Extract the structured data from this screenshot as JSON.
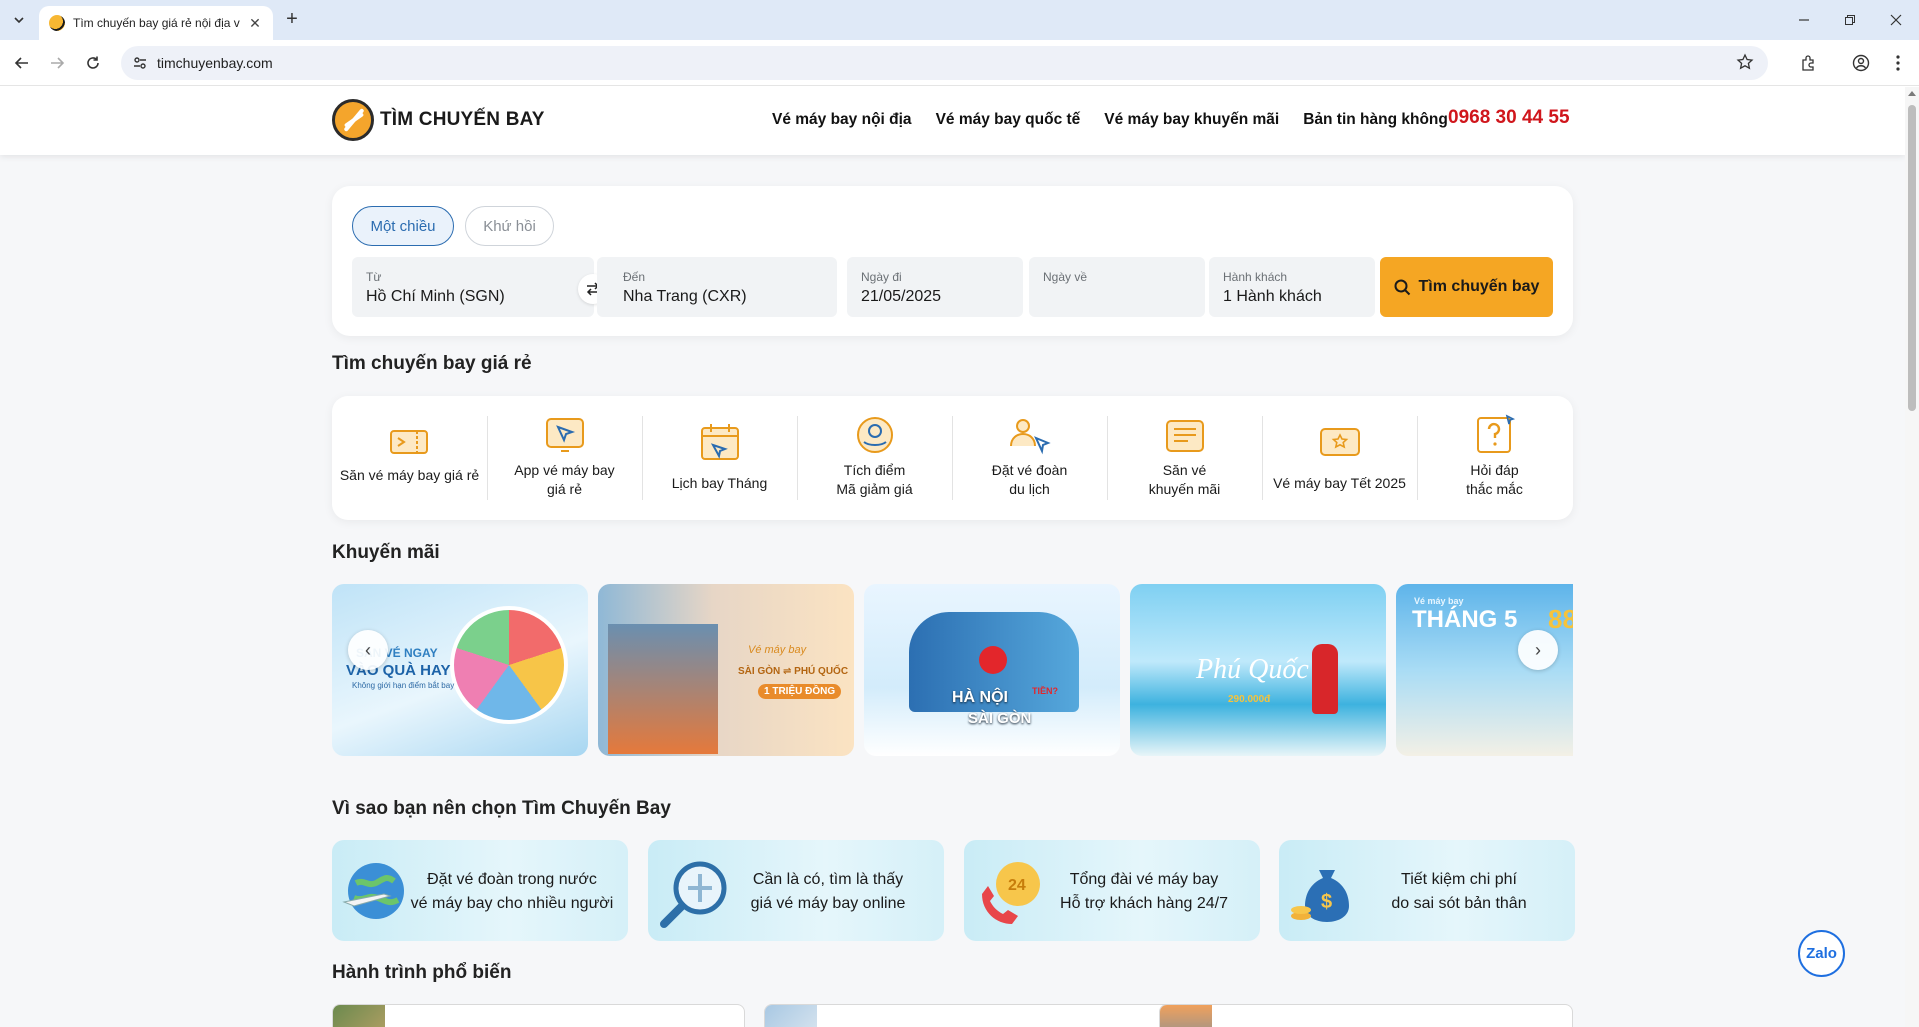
{
  "browser": {
    "tab_title": "Tìm chuyến bay giá rẻ nội địa v",
    "url": "timchuyenbay.com"
  },
  "header": {
    "brand": "TÌM CHUYẾN BAY",
    "nav": [
      "Vé máy bay nội địa",
      "Vé máy bay quốc tế",
      "Vé máy bay khuyến mãi",
      "Bản tin hàng không"
    ],
    "hotline": "0968 30 44 55"
  },
  "search": {
    "trip_oneway": "Một chiều",
    "trip_roundtrip": "Khứ hồi",
    "from_label": "Từ",
    "from_value": "Hồ Chí Minh (SGN)",
    "to_label": "Đến",
    "to_value": "Nha Trang (CXR)",
    "depart_label": "Ngày đi",
    "depart_value": "21/05/2025",
    "return_label": "Ngày về",
    "return_value": "",
    "pax_label": "Hành khách",
    "pax_value": "1 Hành khách",
    "button": "Tìm chuyến bay"
  },
  "features_title": "Tìm chuyến bay giá rẻ",
  "features": [
    {
      "line1": "Săn vé máy bay giá rẻ",
      "line2": "",
      "icon": "ticket-icon"
    },
    {
      "line1": "App vé máy bay",
      "line2": "giá rẻ",
      "icon": "app-icon"
    },
    {
      "line1": "Lịch bay Tháng",
      "line2": "",
      "icon": "calendar-icon"
    },
    {
      "line1": "Tích điểm",
      "line2": "Mã giảm giá",
      "icon": "points-icon"
    },
    {
      "line1": "Đặt vé đoàn",
      "line2": "du lịch",
      "icon": "group-icon"
    },
    {
      "line1": "Săn vé",
      "line2": "khuyến mãi",
      "icon": "newspaper-icon"
    },
    {
      "line1": "Vé máy bay Tết 2025",
      "line2": "",
      "icon": "tet-ticket-icon"
    },
    {
      "line1": "Hỏi đáp",
      "line2": "thắc mắc",
      "icon": "question-icon"
    }
  ],
  "promos_title": "Khuyến mãi",
  "promos": [
    {
      "line1": "SĂN VÉ NGAY",
      "line2": "VÀO QUÀ HAY",
      "line3": "Không giới hạn điểm bắt bay"
    },
    {
      "line1": "Vé máy bay",
      "line2": "SÀI GÒN ⇌ PHÚ QUỐC",
      "line3": "1 TRIỆU ĐỒNG"
    },
    {
      "line1": "HÀ NỘI",
      "line2": "SÀI GÒN",
      "line3": "TIỀN?"
    },
    {
      "line1": "Phú Quốc",
      "line2": "290.000đ",
      "line3": ""
    },
    {
      "line1": "Vé máy bay",
      "line2": "THÁNG 5",
      "line3": "88"
    }
  ],
  "why_title": "Vì sao bạn nên chọn Tìm Chuyến Bay",
  "why": [
    {
      "line1": "Đặt vé đoàn trong nước",
      "line2": "vé máy bay cho nhiều người",
      "icon": "globe-plane-icon"
    },
    {
      "line1": "Cần là có, tìm là thấy",
      "line2": "giá vé máy bay online",
      "icon": "magnifier-plane-icon"
    },
    {
      "line1": "Tổng đài vé máy bay",
      "line2": "Hỗ trợ khách hàng 24/7",
      "icon": "support-24-icon"
    },
    {
      "line1": "Tiết kiệm chi phí",
      "line2": "do sai sót bản thân",
      "icon": "money-bag-icon"
    }
  ],
  "routes_title": "Hành trình phổ biến",
  "zalo": "Zalo",
  "colors": {
    "accent": "#f5a623",
    "hotline": "#d0161c",
    "primary": "#2b6cb0"
  }
}
